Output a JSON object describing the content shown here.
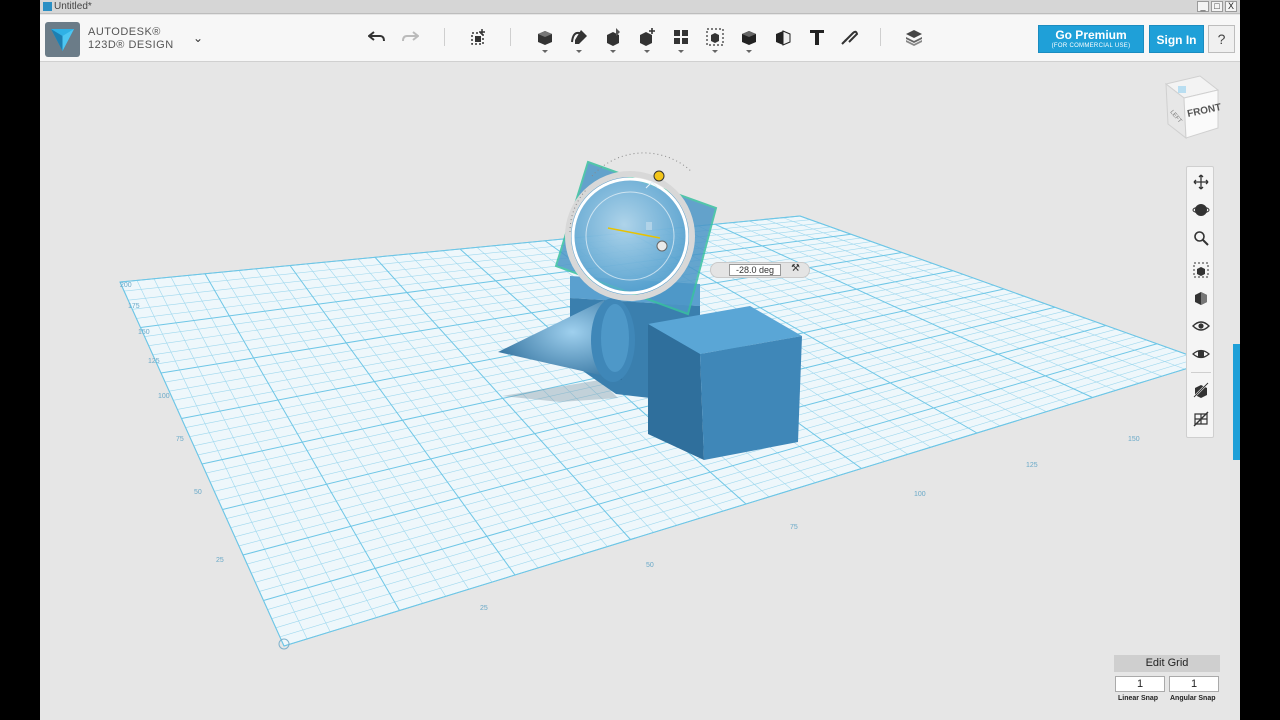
{
  "window": {
    "title": "Untitled*",
    "controls": [
      "_",
      "□",
      "X"
    ]
  },
  "brand": {
    "line1": "AUTODESK®",
    "line2": "123D® DESIGN",
    "menu_chevron": "⌄"
  },
  "toolbar": {
    "icons": [
      "undo-icon",
      "redo-icon",
      "new-primitive-icon",
      "primitives-icon",
      "sketch-icon",
      "construct-icon",
      "modify-icon",
      "pattern-icon",
      "grouping-icon",
      "combine-icon",
      "measure-icon",
      "text-icon",
      "snap-icon",
      "material-icon"
    ]
  },
  "account": {
    "premium_title": "Go Premium",
    "premium_sub": "(FOR COMMERCIAL USE)",
    "signin": "Sign In",
    "help": "?"
  },
  "viewcube": {
    "face_front": "FRONT",
    "face_left": "LEFT"
  },
  "rotate_widget": {
    "angle_value": "-28.0 deg"
  },
  "grid_labels": {
    "left": [
      "200",
      "175",
      "150",
      "125",
      "100",
      "75",
      "50",
      "25"
    ],
    "bottom": [
      "25",
      "50",
      "75",
      "100",
      "125",
      "150"
    ]
  },
  "nav": {
    "items": [
      "pan-icon",
      "orbit-icon",
      "zoom-icon",
      "fit-icon",
      "view-cube-icon",
      "visibility-icon",
      "materials-outline-icon",
      "hide-sketch-icon",
      "hide-mesh-icon"
    ]
  },
  "edit_panel": {
    "edit_grid": "Edit Grid",
    "linear_snap_value": "1",
    "angular_snap_value": "1",
    "linear_snap_label": "Linear Snap",
    "angular_snap_label": "Angular Snap"
  },
  "colors": {
    "accent": "#1fa0d8",
    "grid_line": "#6ec6e6",
    "grid_fill": "#eef7fb",
    "solid": "#3f87b8"
  }
}
